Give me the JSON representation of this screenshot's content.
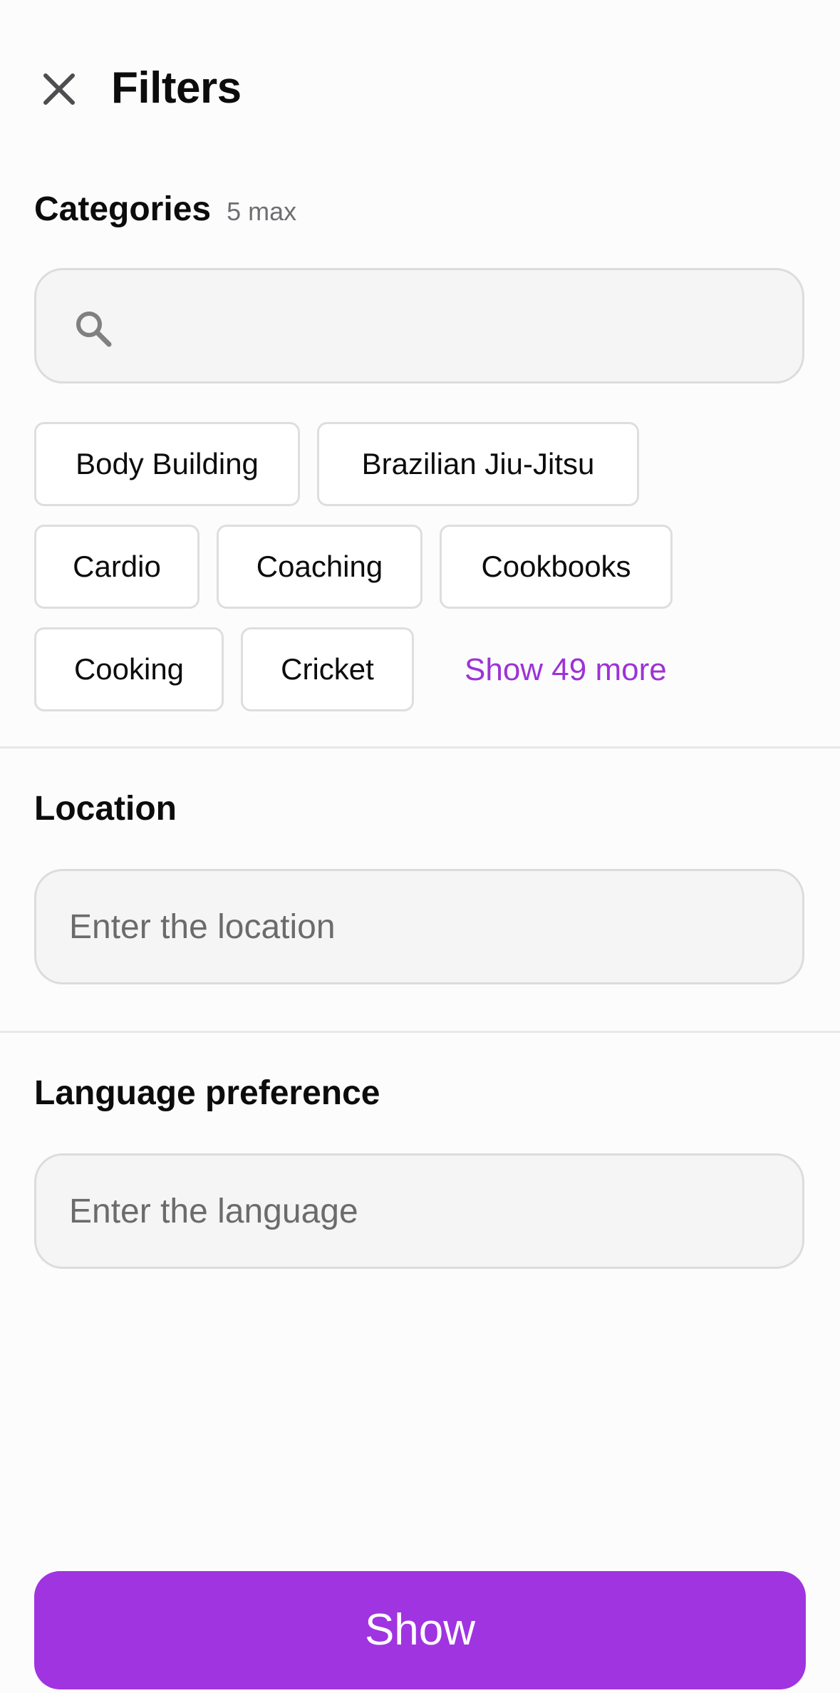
{
  "header": {
    "title": "Filters",
    "close_icon": "close-icon"
  },
  "categories": {
    "title": "Categories",
    "hint": "5 max",
    "search_placeholder": "",
    "search_icon": "search-icon",
    "chips": [
      "Body Building",
      "Brazilian Jiu-Jitsu",
      "Cardio",
      "Coaching",
      "Cookbooks",
      "Cooking",
      "Cricket"
    ],
    "show_more": "Show 49 more"
  },
  "location": {
    "title": "Location",
    "placeholder": "Enter the location"
  },
  "language": {
    "title": "Language preference",
    "placeholder": "Enter the language"
  },
  "footer": {
    "show_label": "Show"
  },
  "colors": {
    "accent": "#a034e0",
    "link": "#9c33d6",
    "input_bg": "#f5f5f5"
  }
}
